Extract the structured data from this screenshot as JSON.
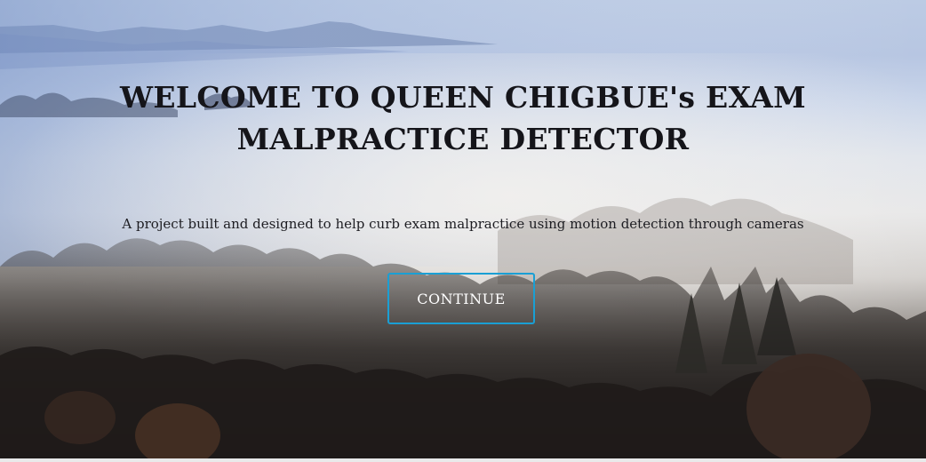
{
  "hero": {
    "title": "WELCOME TO QUEEN CHIGBUE's EXAM MALPRACTICE DETECTOR",
    "subtitle": "A project built and designed to help curb exam malpractice using motion detection through cameras",
    "continue_label": "CONTINUE"
  },
  "colors": {
    "sky_blue": "#b7c6e2",
    "fog": "#e7e7e8",
    "forest_dark": "#2a2624",
    "button_border": "#1a9fd4",
    "title_text": "#15151a"
  },
  "background": {
    "scene": "misty-forest-photo"
  }
}
